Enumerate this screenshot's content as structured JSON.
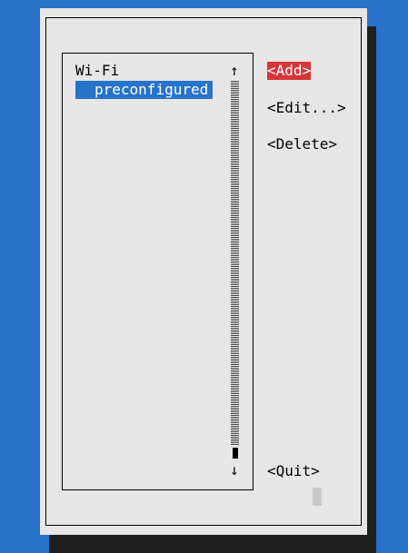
{
  "list": {
    "group_label": "Wi-Fi",
    "items": [
      {
        "label": "preconfigured",
        "selected": true
      }
    ],
    "scroll_up_icon": "arrow-up",
    "scroll_down_icon": "arrow-down",
    "scroll_up_glyph": "↑",
    "scroll_down_glyph": "↓"
  },
  "buttons": {
    "add": "<Add>",
    "edit": "<Edit...>",
    "delete": "<Delete>",
    "quit": "<Quit>"
  },
  "colors": {
    "background": "#2673c9",
    "dialog": "#e6e6e6",
    "selection": "#2673c9",
    "active_button": "#d3363b"
  }
}
